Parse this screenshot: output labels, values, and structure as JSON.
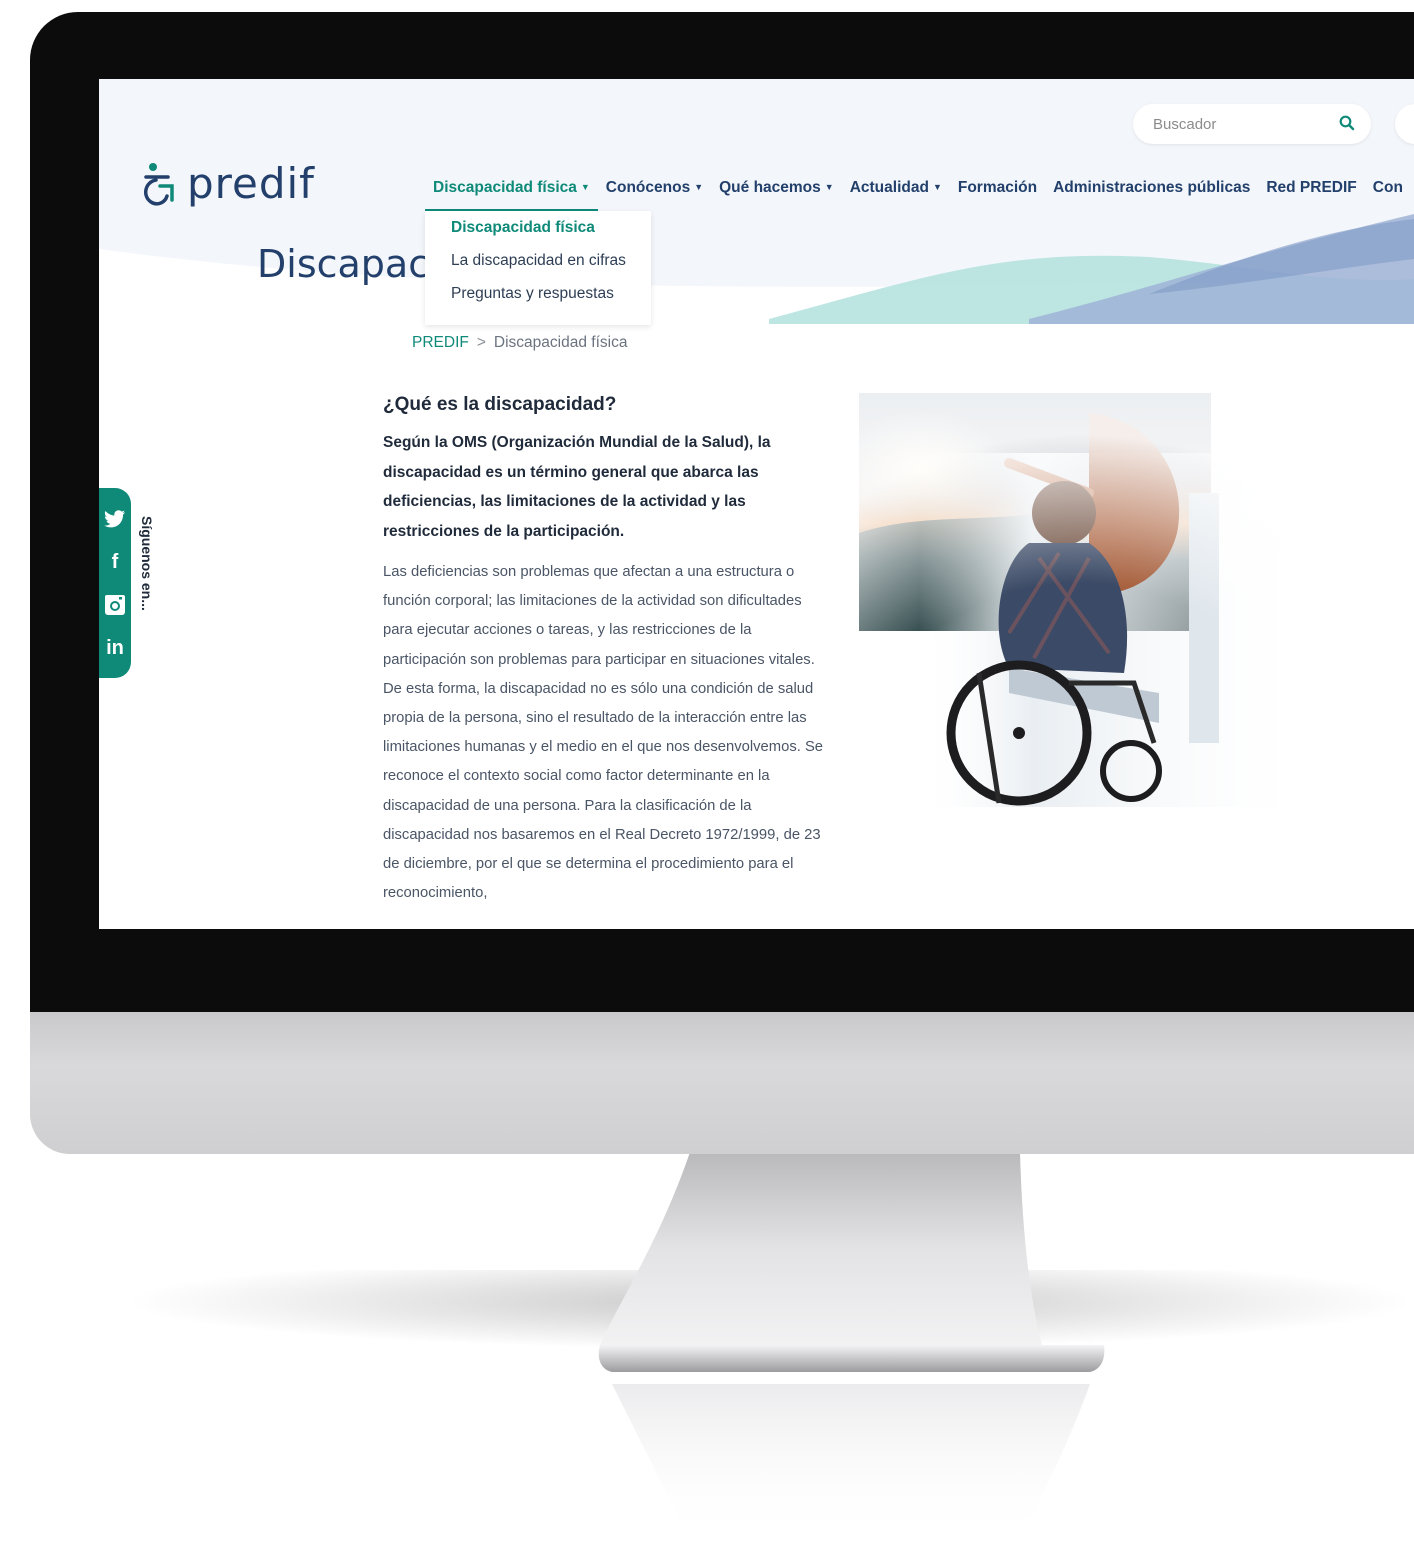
{
  "brand": {
    "name": "predif",
    "color": "#22406b",
    "accent": "#0f8a79"
  },
  "search": {
    "placeholder": "Buscador"
  },
  "nav": {
    "items": [
      {
        "label": "Discapacidad física",
        "has_caret": true,
        "active": true
      },
      {
        "label": "Conócenos",
        "has_caret": true
      },
      {
        "label": "Qué hacemos",
        "has_caret": true
      },
      {
        "label": "Actualidad",
        "has_caret": true
      },
      {
        "label": "Formación",
        "has_caret": false
      },
      {
        "label": "Administraciones públicas",
        "has_caret": false
      },
      {
        "label": "Red PREDIF",
        "has_caret": false
      },
      {
        "label": "Con",
        "has_caret": false
      }
    ],
    "caret": "▼"
  },
  "dropdown": {
    "items": [
      {
        "label": "Discapacidad física",
        "active": true
      },
      {
        "label": "La discapacidad en cifras"
      },
      {
        "label": "Preguntas y respuestas"
      }
    ]
  },
  "page": {
    "title": "Discapaci"
  },
  "breadcrumb": {
    "home": "PREDIF",
    "separator": ">",
    "current": "Discapacidad física"
  },
  "content": {
    "heading": "¿Qué es la discapacidad?",
    "lead": "Según la OMS (Organización Mundial de la Salud), la discapacidad es un término general que abarca las deficiencias, las limitaciones de la actividad y las restricciones de la participación.",
    "body": "Las deficiencias son problemas que afectan a una estructura o función corporal; las limitaciones de la actividad son dificultades para ejecutar acciones o tareas, y las restricciones de la participación son problemas para participar en situaciones vitales. De esta forma, la discapacidad no es sólo una condición de salud propia de la persona, sino el resultado de la interacción entre las limitaciones humanas y el medio en el que nos desenvolvemos. Se reconoce el contexto social como factor determinante en la discapacidad de una persona. Para la clasificación de la discapacidad nos basaremos en el Real Decreto 1972/1999, de 23 de diciembre, por el que se determina el procedimiento para el reconocimiento,"
  },
  "social": {
    "label": "Síguenos en...",
    "icons": [
      "twitter-icon",
      "facebook-icon",
      "instagram-icon",
      "linkedin-icon"
    ],
    "linkedin_text": "in",
    "facebook_text": "f"
  }
}
